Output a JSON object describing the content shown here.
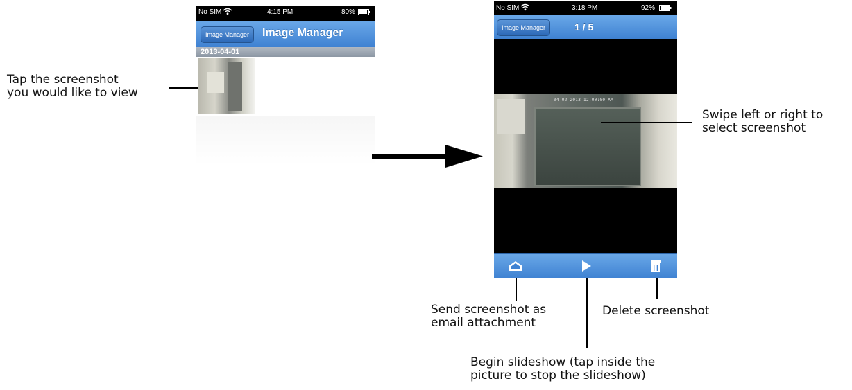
{
  "left_screen": {
    "status": {
      "carrier": "No SIM",
      "time": "4:15 PM",
      "battery": "80%"
    },
    "nav": {
      "back_label": "Image Manager",
      "title": "Image Manager"
    },
    "date_header": "2013-04-01"
  },
  "right_screen": {
    "status": {
      "carrier": "No SIM",
      "time": "3:18 PM",
      "battery": "92%"
    },
    "nav": {
      "back_label": "Image Manager",
      "counter": "1 / 5"
    },
    "photo_timestamp": "04-02-2013 12:00:00 AM",
    "toolbar": {
      "email": "envelope-icon",
      "play": "play-icon",
      "delete": "trash-icon"
    }
  },
  "annotations": {
    "tap_screenshot": "Tap the screenshot\nyou would like to view",
    "swipe": "Swipe left or right to\nselect screenshot",
    "send_email": "Send screenshot as\nemail attachment",
    "delete": "Delete screenshot",
    "slideshow": "Begin slideshow (tap inside the\npicture to stop the slideshow)"
  },
  "colors": {
    "nav_blue": "#3f82d2",
    "status_bg": "#000000",
    "arrow": "#000000"
  }
}
